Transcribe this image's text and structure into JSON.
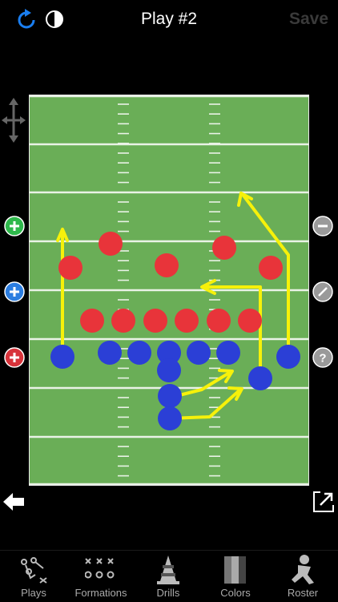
{
  "header": {
    "title": "Play #2",
    "save_label": "Save"
  },
  "tabs": [
    {
      "label": "Plays",
      "icon": "plays-icon"
    },
    {
      "label": "Formations",
      "icon": "formations-icon"
    },
    {
      "label": "Drills",
      "icon": "drills-icon"
    },
    {
      "label": "Colors",
      "icon": "colors-icon"
    },
    {
      "label": "Roster",
      "icon": "roster-icon"
    }
  ],
  "colors": {
    "field": "#6aae57",
    "defense": "#e8343a",
    "offense": "#2b3fd6",
    "route": "#f6f10a",
    "accent": "#1a7ef0"
  }
}
